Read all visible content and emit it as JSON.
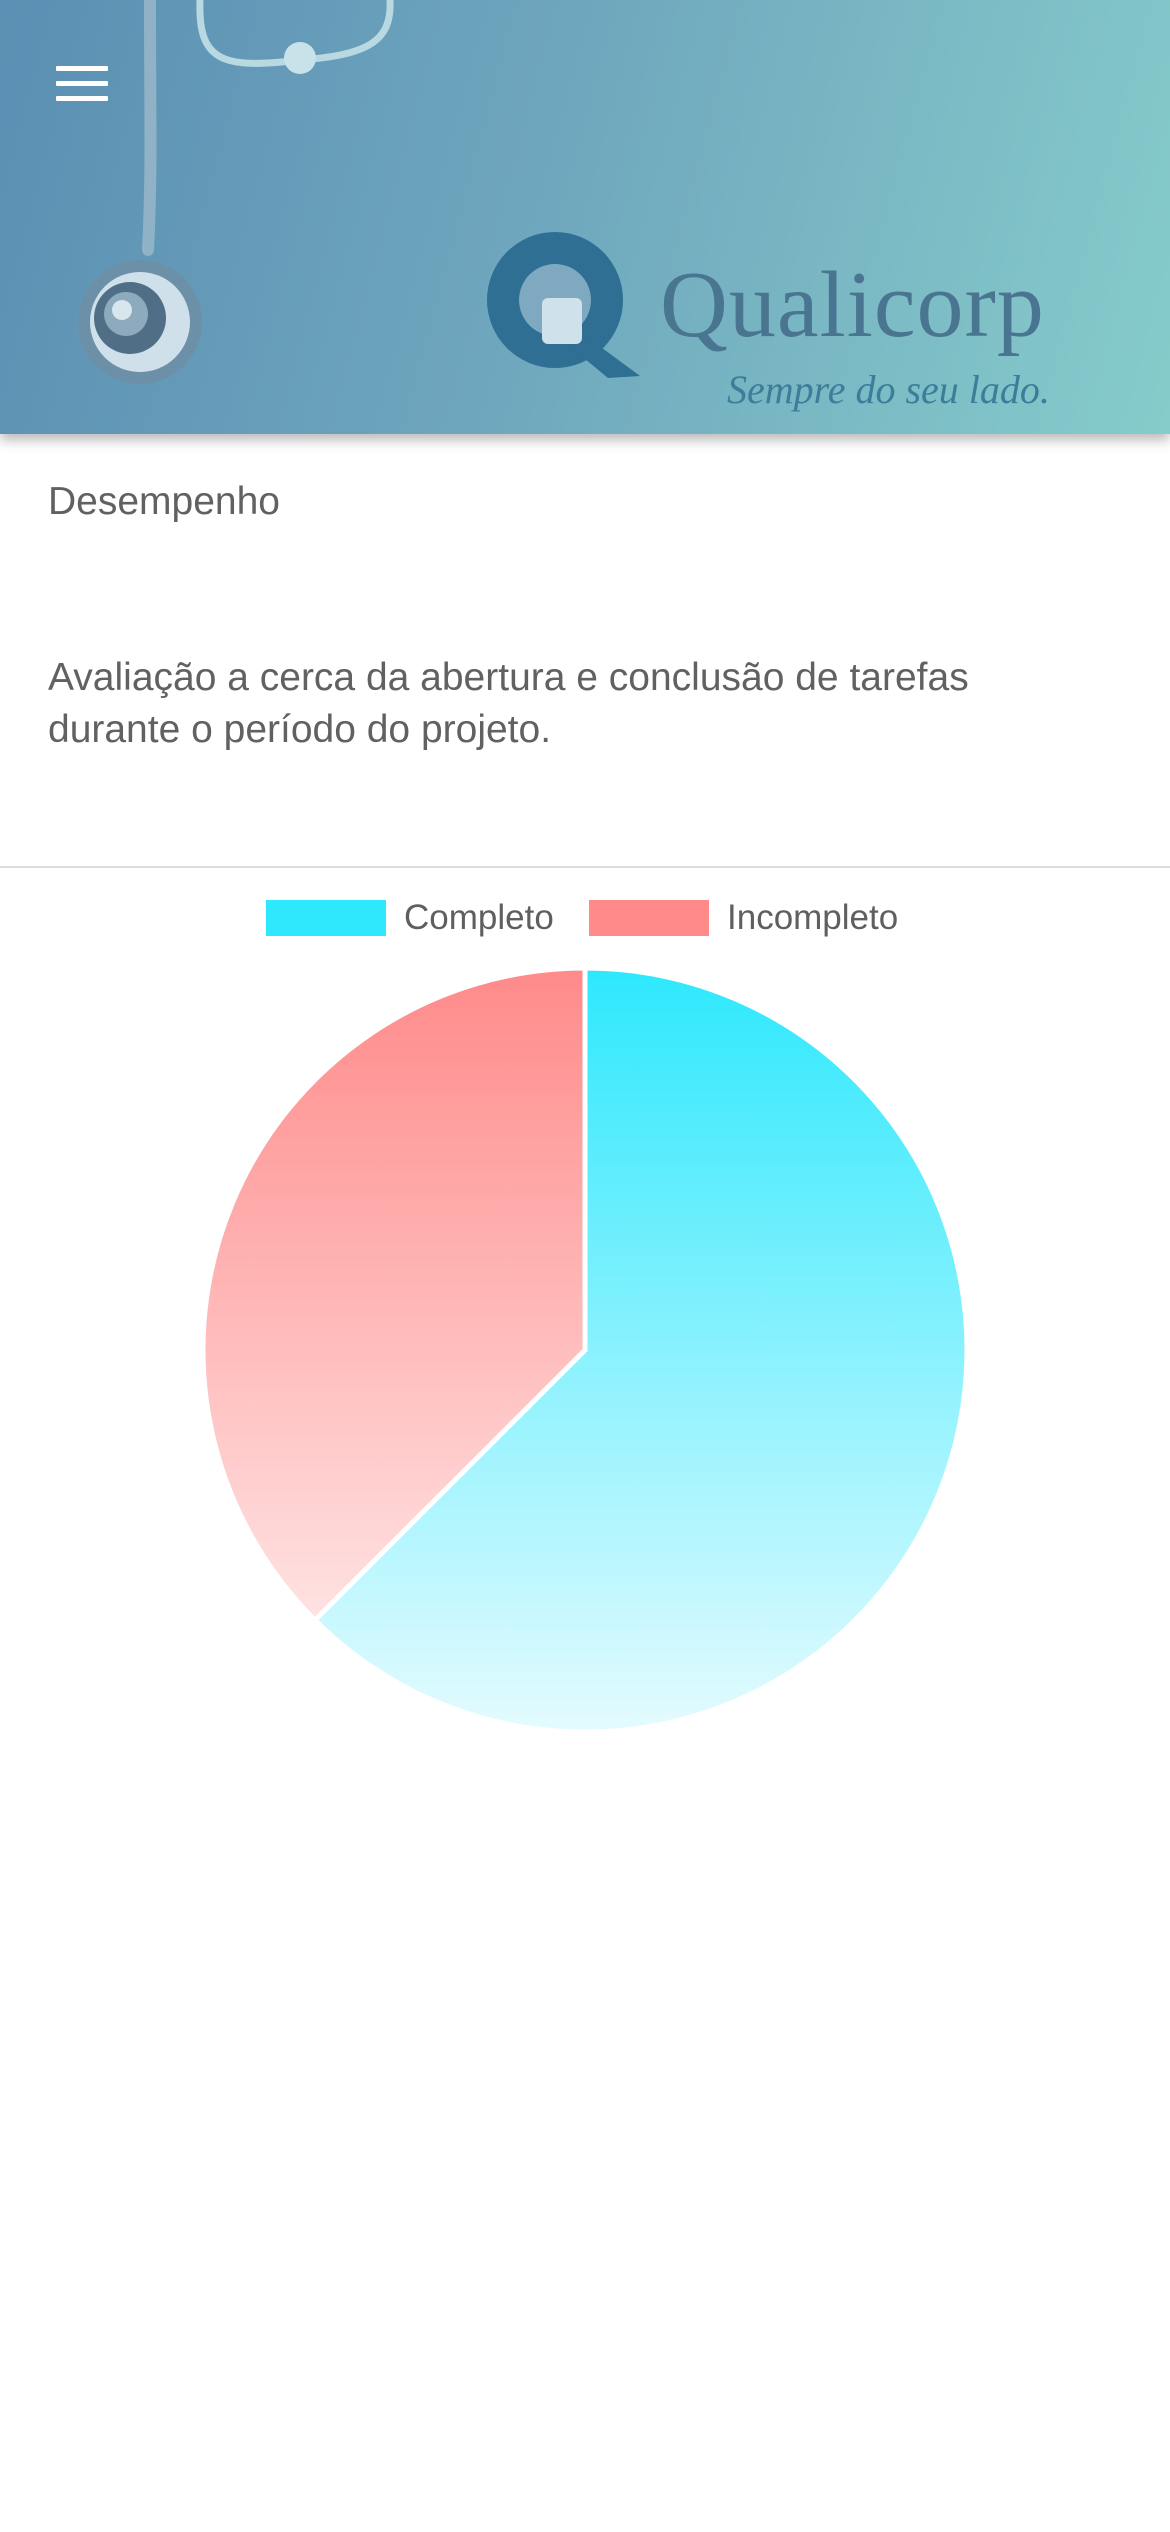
{
  "header": {
    "logo_name": "Qualicorp",
    "logo_tagline": "Sempre do seu lado.",
    "menu_icon": "hamburger-menu-icon"
  },
  "page": {
    "section_title": "Desempenho",
    "description": "Avaliação a cerca da abertura e conclusão de tarefas durante o período do projeto."
  },
  "colors": {
    "complete": "#2ee8fd",
    "incomplete": "#ff8a8a",
    "complete_light": "#e4fbfe",
    "incomplete_light": "#ffe2e2"
  },
  "chart_data": {
    "type": "pie",
    "categories": [
      "Completo",
      "Incompleto"
    ],
    "values": [
      62.5,
      37.5
    ],
    "legend_position": "top"
  }
}
